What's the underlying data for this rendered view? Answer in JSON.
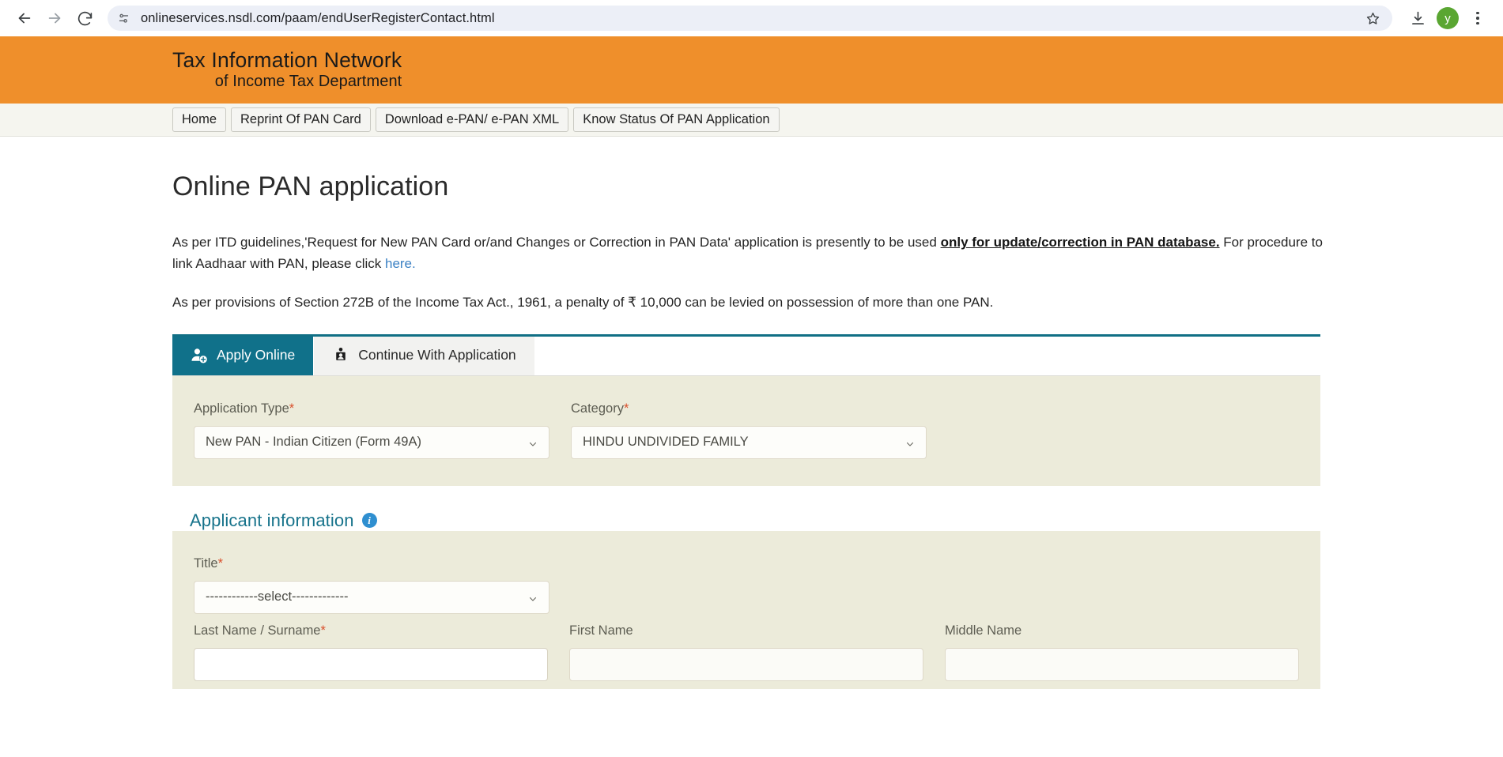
{
  "browser": {
    "url": "onlineservices.nsdl.com/paam/endUserRegisterContact.html",
    "back_label": "Back",
    "forward_label": "Forward",
    "reload_label": "Reload",
    "site_info_label": "View site information",
    "bookmark_label": "Bookmark this tab",
    "download_label": "Downloads",
    "profile_initial": "y",
    "menu_label": "Customize and control Google Chrome"
  },
  "header": {
    "logo_line1": "Tax Information Network",
    "logo_line2": "of Income Tax Department"
  },
  "nav": {
    "items": [
      {
        "label": "Home"
      },
      {
        "label": "Reprint Of PAN Card"
      },
      {
        "label": "Download e-PAN/ e-PAN XML"
      },
      {
        "label": "Know Status Of PAN Application"
      }
    ]
  },
  "main": {
    "title": "Online PAN application",
    "intro1_part1": "As per ITD guidelines,'Request for New PAN Card or/and Changes or Correction in PAN Data' application is presently to be used ",
    "intro1_bold": "only for update/correction in PAN database.",
    "intro1_part2": " For procedure to link Aadhaar with PAN, please click ",
    "intro1_link": "here.",
    "intro2": "As per provisions of Section 272B of the Income Tax Act., 1961, a penalty of ₹ 10,000 can be levied on possession of more than one PAN.",
    "tabs": [
      {
        "label": "Apply Online",
        "icon": "user-plus-icon",
        "active": true
      },
      {
        "label": "Continue With Application",
        "icon": "user-resume-icon",
        "active": false
      }
    ]
  },
  "form": {
    "application_type": {
      "label": "Application Type",
      "required": "*",
      "value": "New PAN - Indian Citizen (Form 49A)"
    },
    "category": {
      "label": "Category",
      "required": "*",
      "value": "HINDU UNDIVIDED FAMILY"
    },
    "applicant_section": {
      "heading": "Applicant information",
      "info_icon": "info-icon",
      "info_glyph": "i"
    },
    "title_field": {
      "label": "Title",
      "required": "*",
      "value": "------------select-------------"
    },
    "last_name": {
      "label": "Last Name / Surname",
      "required": "*",
      "value": "",
      "placeholder": ""
    },
    "first_name": {
      "label": "First Name",
      "value": "",
      "placeholder": ""
    },
    "middle_name": {
      "label": "Middle Name",
      "value": "",
      "placeholder": ""
    }
  },
  "colors": {
    "brand_orange": "#ef8f2b",
    "brand_teal": "#10718a",
    "panel_beige": "#ecebda",
    "link_blue": "#3c82c4",
    "required_red": "#d94f2b",
    "avatar_green": "#5aa632"
  }
}
